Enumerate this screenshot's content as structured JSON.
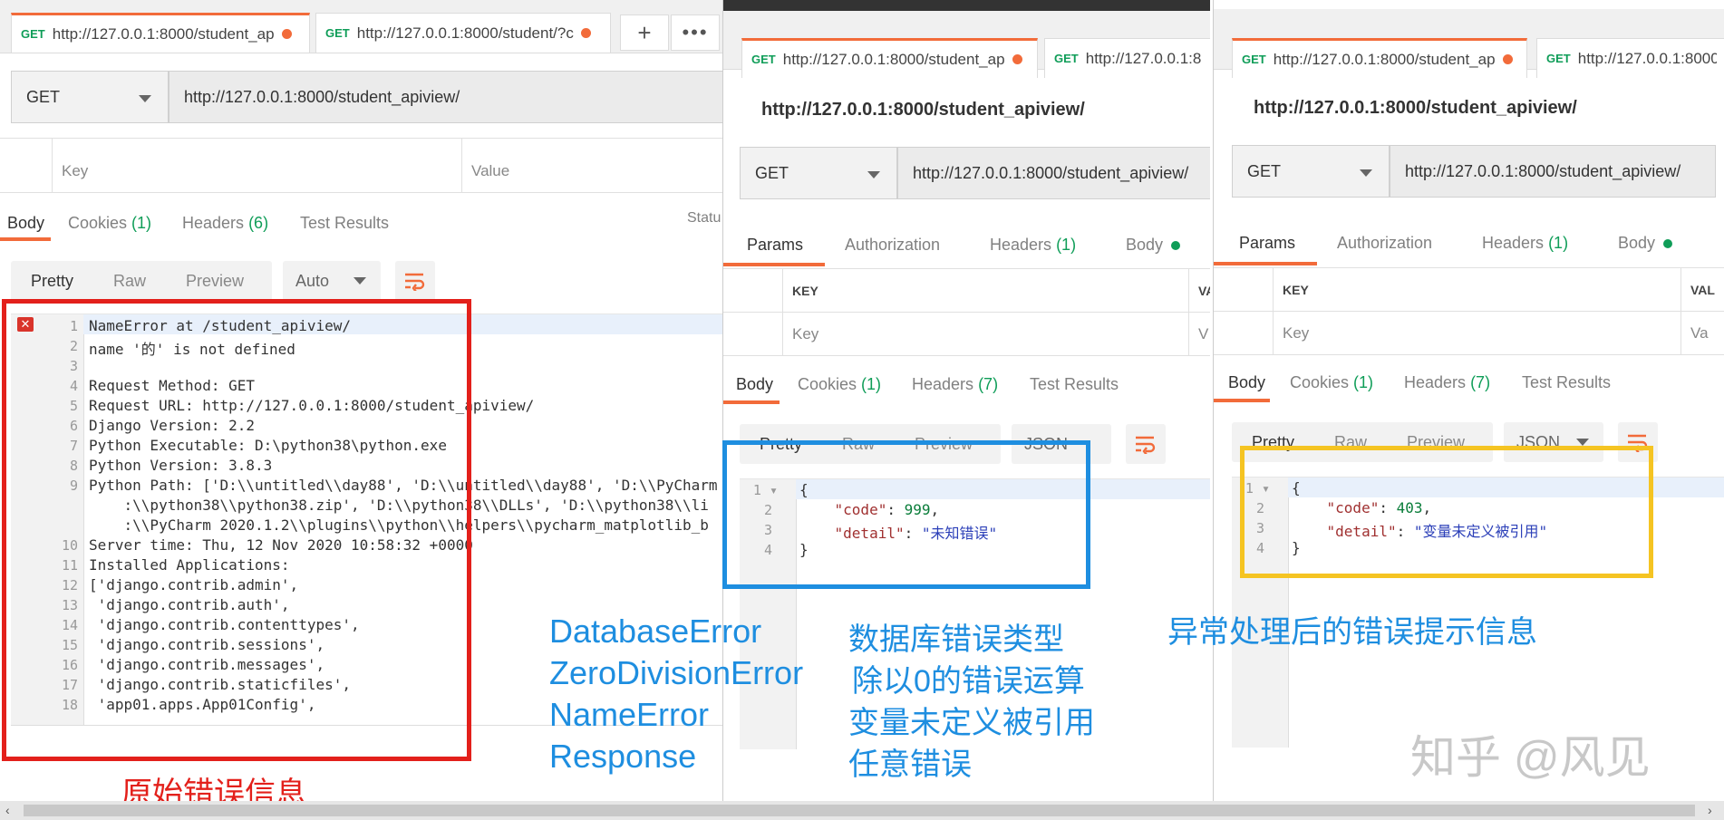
{
  "panel1": {
    "tabs": [
      {
        "method": "GET",
        "url": "http://127.0.0.1:8000/student_ap"
      },
      {
        "method": "GET",
        "url": "http://127.0.0.1:8000/student/?c"
      }
    ],
    "add_icon": "plus-icon",
    "more_icon": "more-icon",
    "request": {
      "method": "GET",
      "url": "http://127.0.0.1:8000/student_apiview/"
    },
    "params": {
      "key_placeholder": "Key",
      "value_placeholder": "Value"
    },
    "response_tabs": [
      {
        "label": "Body",
        "count": ""
      },
      {
        "label": "Cookies",
        "count": "(1)"
      },
      {
        "label": "Headers",
        "count": "(6)"
      },
      {
        "label": "Test Results",
        "count": ""
      }
    ],
    "status_cut": "Statu",
    "view_modes": [
      "Pretty",
      "Raw",
      "Preview"
    ],
    "format": "Auto",
    "code_lines": [
      {
        "n": "1",
        "t": "NameError at /student_apiview/"
      },
      {
        "n": "2",
        "t": "name '的' is not defined"
      },
      {
        "n": "3",
        "t": ""
      },
      {
        "n": "4",
        "t": "Request Method: GET"
      },
      {
        "n": "5",
        "t": "Request URL: http://127.0.0.1:8000/student_apiview/"
      },
      {
        "n": "6",
        "t": "Django Version: 2.2"
      },
      {
        "n": "7",
        "t": "Python Executable: D:\\python38\\python.exe"
      },
      {
        "n": "8",
        "t": "Python Version: 3.8.3"
      },
      {
        "n": "9",
        "t": "Python Path: ['D:\\\\untitled\\\\day88', 'D:\\\\untitled\\\\day88', 'D:\\\\PyCharm"
      },
      {
        "n": "",
        "t": "    :\\\\python38\\\\python38.zip', 'D:\\\\python38\\\\DLLs', 'D:\\\\python38\\\\li"
      },
      {
        "n": "",
        "t": "    :\\\\PyCharm 2020.1.2\\\\plugins\\\\python\\\\helpers\\\\pycharm_matplotlib_b"
      },
      {
        "n": "10",
        "t": "Server time: Thu, 12 Nov 2020 10:58:32 +0000"
      },
      {
        "n": "11",
        "t": "Installed Applications:"
      },
      {
        "n": "12",
        "t": "['django.contrib.admin',"
      },
      {
        "n": "13",
        "t": " 'django.contrib.auth',"
      },
      {
        "n": "14",
        "t": " 'django.contrib.contenttypes',"
      },
      {
        "n": "15",
        "t": " 'django.contrib.sessions',"
      },
      {
        "n": "16",
        "t": " 'django.contrib.messages',"
      },
      {
        "n": "17",
        "t": " 'django.contrib.staticfiles',"
      },
      {
        "n": "18",
        "t": " 'app01.apps.App01Config',"
      }
    ]
  },
  "panel2": {
    "tabs": [
      {
        "method": "GET",
        "url": "http://127.0.0.1:8000/student_ap"
      },
      {
        "method": "GET",
        "url": "http://127.0.0.1:8"
      }
    ],
    "url_title": "http://127.0.0.1:8000/student_apiview/",
    "request": {
      "method": "GET",
      "url": "http://127.0.0.1:8000/student_apiview/"
    },
    "request_tabs": [
      {
        "label": "Params",
        "count": ""
      },
      {
        "label": "Authorization",
        "count": ""
      },
      {
        "label": "Headers",
        "count": "(1)"
      },
      {
        "label": "Body",
        "count": ""
      }
    ],
    "table": {
      "key_header": "KEY",
      "value_header": "VA",
      "key_placeholder": "Key",
      "value_placeholder": "V"
    },
    "response_tabs": [
      {
        "label": "Body",
        "count": ""
      },
      {
        "label": "Cookies",
        "count": "(1)"
      },
      {
        "label": "Headers",
        "count": "(7)"
      },
      {
        "label": "Test Results",
        "count": ""
      }
    ],
    "view_modes": [
      "Pretty",
      "Raw",
      "Preview"
    ],
    "format": "JSON",
    "json": {
      "code": "999",
      "detail": "\"未知错误\""
    }
  },
  "panel3": {
    "tabs": [
      {
        "method": "GET",
        "url": "http://127.0.0.1:8000/student_ap"
      },
      {
        "method": "GET",
        "url": "http://127.0.0.1:8000/"
      }
    ],
    "url_title": "http://127.0.0.1:8000/student_apiview/",
    "request": {
      "method": "GET",
      "url": "http://127.0.0.1:8000/student_apiview/"
    },
    "request_tabs": [
      {
        "label": "Params",
        "count": ""
      },
      {
        "label": "Authorization",
        "count": ""
      },
      {
        "label": "Headers",
        "count": "(1)"
      },
      {
        "label": "Body",
        "count": ""
      }
    ],
    "table": {
      "key_header": "KEY",
      "value_header": "VAL",
      "key_placeholder": "Key",
      "value_placeholder": "Va"
    },
    "response_tabs": [
      {
        "label": "Body",
        "count": ""
      },
      {
        "label": "Cookies",
        "count": "(1)"
      },
      {
        "label": "Headers",
        "count": "(7)"
      },
      {
        "label": "Test Results",
        "count": ""
      }
    ],
    "view_modes": [
      "Pretty",
      "Raw",
      "Preview"
    ],
    "format": "JSON",
    "json": {
      "code": "403",
      "detail": "\"变量未定义被引用\""
    }
  },
  "annotations": {
    "red_label": "原始错误信息",
    "error_types": [
      "DatabaseError",
      "ZeroDivisionError",
      "NameError",
      "Response"
    ],
    "error_descriptions": [
      "数据库错误类型",
      "除以0的错误运算",
      "变量未定义被引用",
      "任意错误"
    ],
    "yellow_label": "异常处理后的错误提示信息",
    "watermark": "知乎 @风见"
  },
  "colors": {
    "accent": "#f26b3a",
    "green": "#0f9d58",
    "red_box": "#e3201b",
    "blue_box": "#1e8ee0",
    "yellow_box": "#f5c422",
    "annotation_blue": "#1e8ee0"
  }
}
